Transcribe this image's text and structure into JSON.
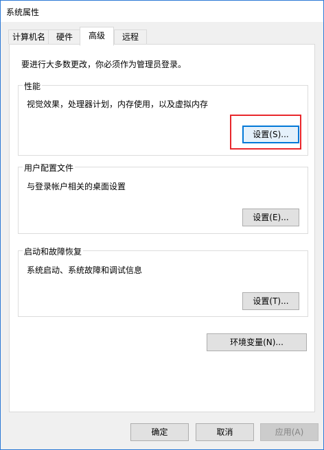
{
  "window": {
    "title": "系统属性"
  },
  "tabs": [
    {
      "label": "计算机名",
      "active": false
    },
    {
      "label": "硬件",
      "active": false
    },
    {
      "label": "高级",
      "active": true
    },
    {
      "label": "远程",
      "active": false
    }
  ],
  "advanced": {
    "intro": "要进行大多数更改，你必须作为管理员登录。",
    "performance": {
      "title": "性能",
      "description": "视觉效果，处理器计划，内存使用，以及虚拟内存",
      "button": "设置(S)..."
    },
    "user_profiles": {
      "title": "用户配置文件",
      "description": "与登录帐户相关的桌面设置",
      "button": "设置(E)..."
    },
    "startup_recovery": {
      "title": "启动和故障恢复",
      "description": "系统启动、系统故障和调试信息",
      "button": "设置(T)..."
    },
    "env_button": "环境变量(N)..."
  },
  "footer": {
    "ok": "确定",
    "cancel": "取消",
    "apply": "应用(A)"
  },
  "colors": {
    "accent": "#0078d7",
    "highlight_box": "#e8262b"
  }
}
